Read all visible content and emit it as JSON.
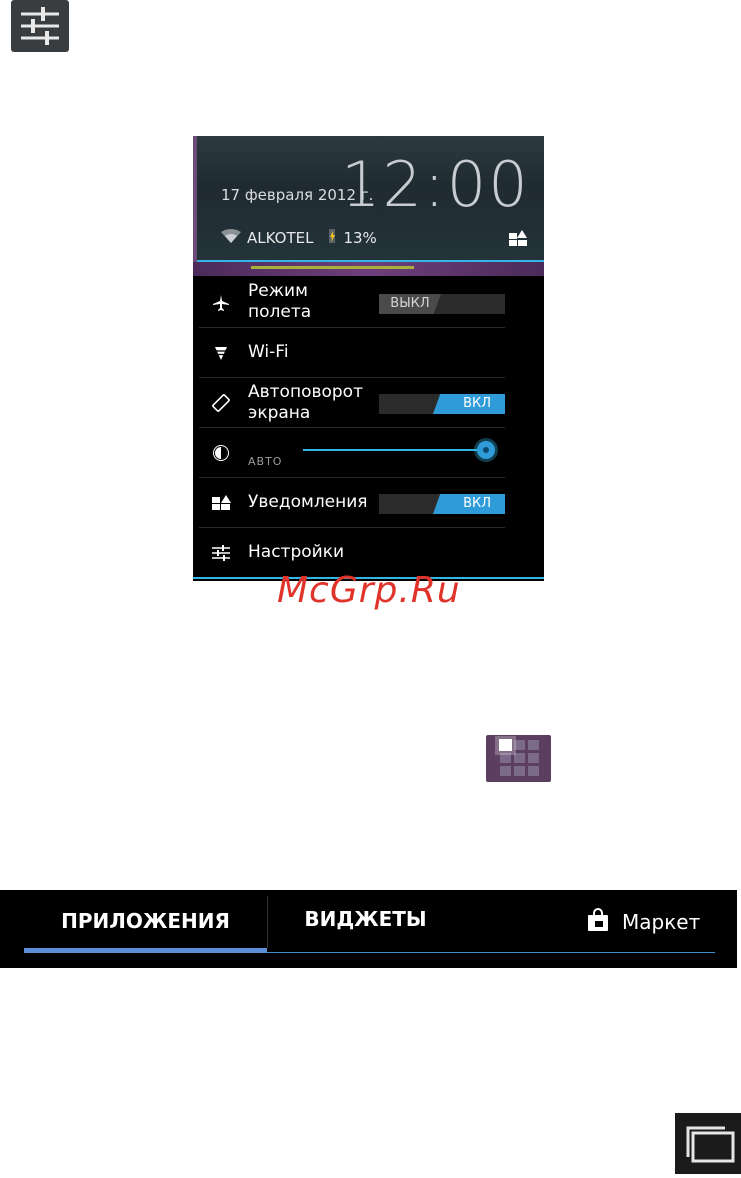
{
  "top_icon": {
    "name": "settings-sliders-icon"
  },
  "panel": {
    "clock": "12:00",
    "date": "17 февраля 2012 г.",
    "carrier": "ALKOTEL",
    "battery": "13%",
    "rows": [
      {
        "label_line1": "Режим",
        "label_line2": "полета",
        "icon": "airplane-icon",
        "toggle_text": "ВЫКЛ",
        "state": "off"
      },
      {
        "label": "Wi-Fi",
        "icon": "wifi-icon"
      },
      {
        "label_line1": "Автоповорот",
        "label_line2": "экрана",
        "icon": "rotate-icon",
        "toggle_text": "ВКЛ",
        "state": "on"
      },
      {
        "slider_label": "АВТО",
        "icon": "brightness-icon",
        "level": 1.0
      },
      {
        "label": "Уведомления",
        "icon": "notifications-icon",
        "toggle_text": "ВКЛ",
        "state": "on"
      },
      {
        "label": "Настройки",
        "icon": "settings-icon"
      }
    ]
  },
  "watermark": "McGrp.Ru",
  "apps_icon": {
    "name": "all-apps-grid-icon"
  },
  "tabbar": {
    "tab_apps": "ПРИЛОЖЕНИЯ",
    "tab_widgets": "ВИДЖЕТЫ",
    "market": "Маркет"
  },
  "recent_icon": {
    "name": "recent-apps-icon"
  },
  "colors": {
    "accent": "#33b5e5",
    "toggle_on": "#2f9bd8",
    "tab_underline": "#5a8fd8",
    "watermark": "#e0332a"
  }
}
